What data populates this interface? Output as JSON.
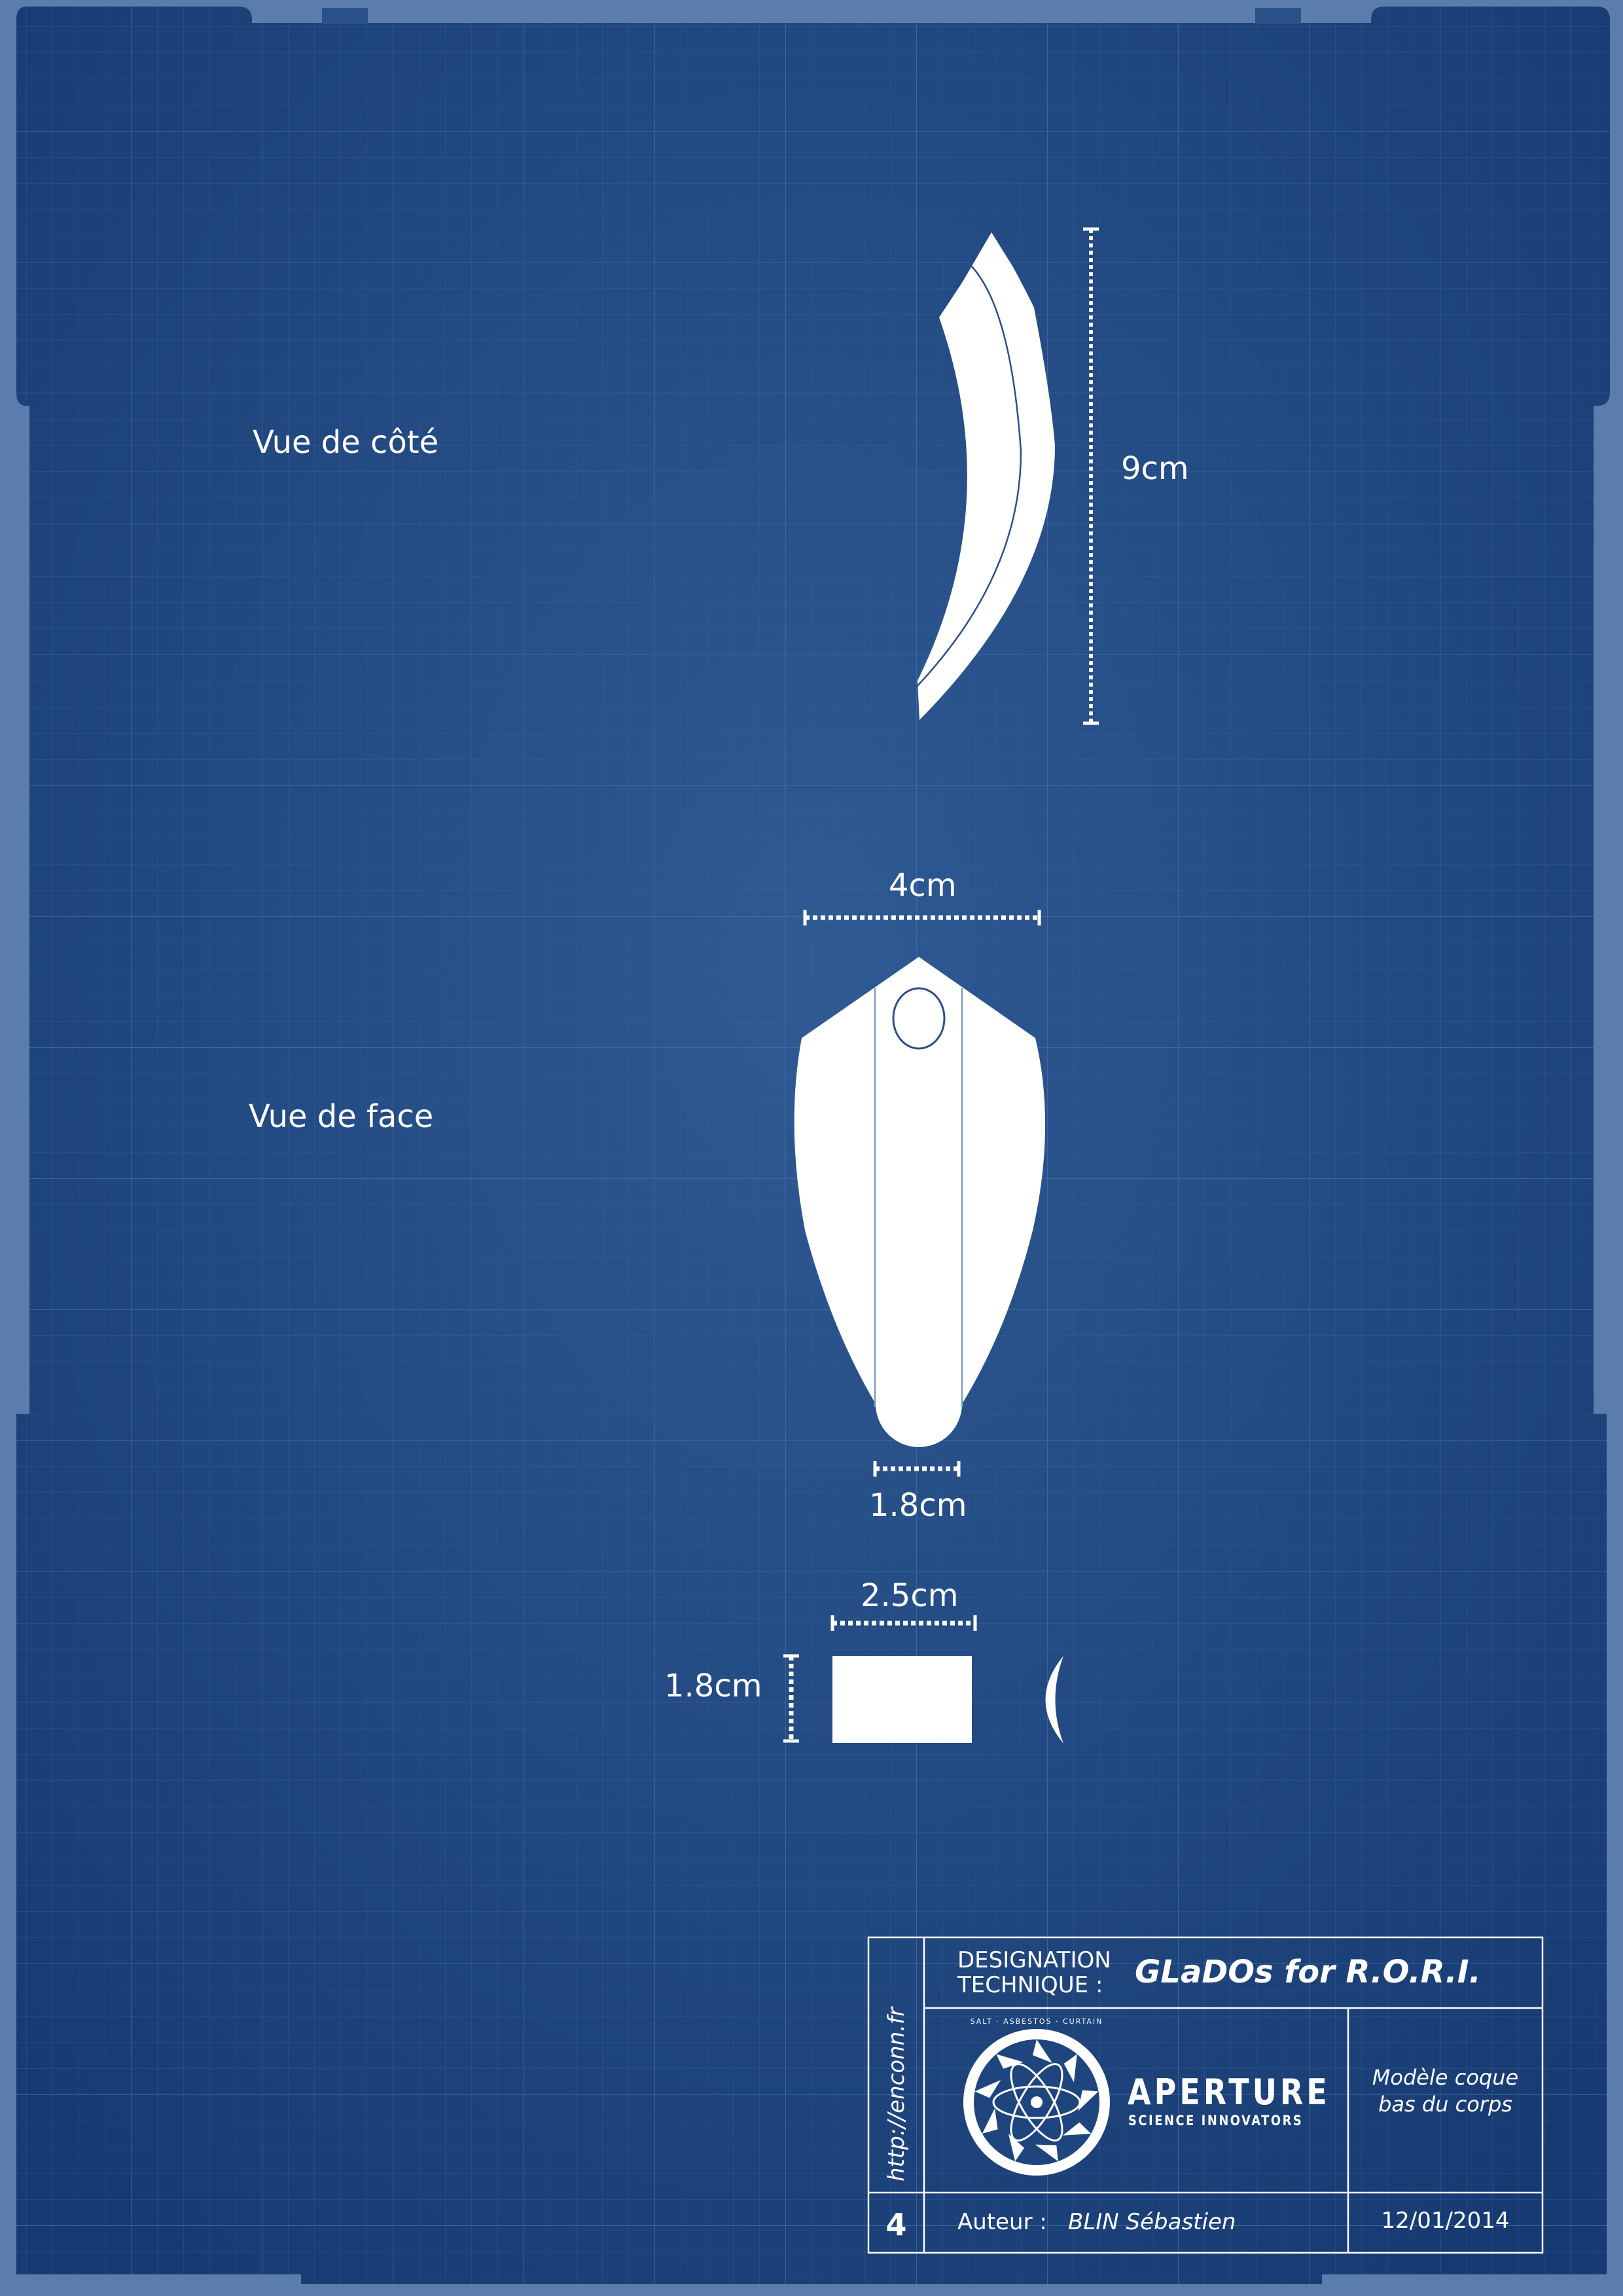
{
  "colors": {
    "paper": "#1b3f78",
    "paper_light": "#2c558f",
    "border_frame": "#5d7fae",
    "grid": "#3d64a0",
    "ink": "#ffffff"
  },
  "views": {
    "side_label": "Vue de côté",
    "front_label": "Vue de face"
  },
  "dimensions": {
    "side_height": "9cm",
    "front_width": "4cm",
    "front_tip_width": "1.8cm",
    "tab_width": "2.5cm",
    "tab_height": "1.8cm"
  },
  "title_block": {
    "url": "http://enconn.fr",
    "designation_line1": "DESIGNATION",
    "designation_line2": "TECHNIQUE  :",
    "project_title": "GLaDOs for R.O.R.I.",
    "logo_ring_text": "SALT · ASBESTOS · CURTAIN",
    "logo_name": "APERTURE",
    "logo_tagline": "SCIENCE INNOVATORS",
    "description_line1": "Modèle coque",
    "description_line2": "bas du corps",
    "sheet_number": "4",
    "author_label": "Auteur :",
    "author_name": "BLIN Sébastien",
    "date": "12/01/2014"
  }
}
